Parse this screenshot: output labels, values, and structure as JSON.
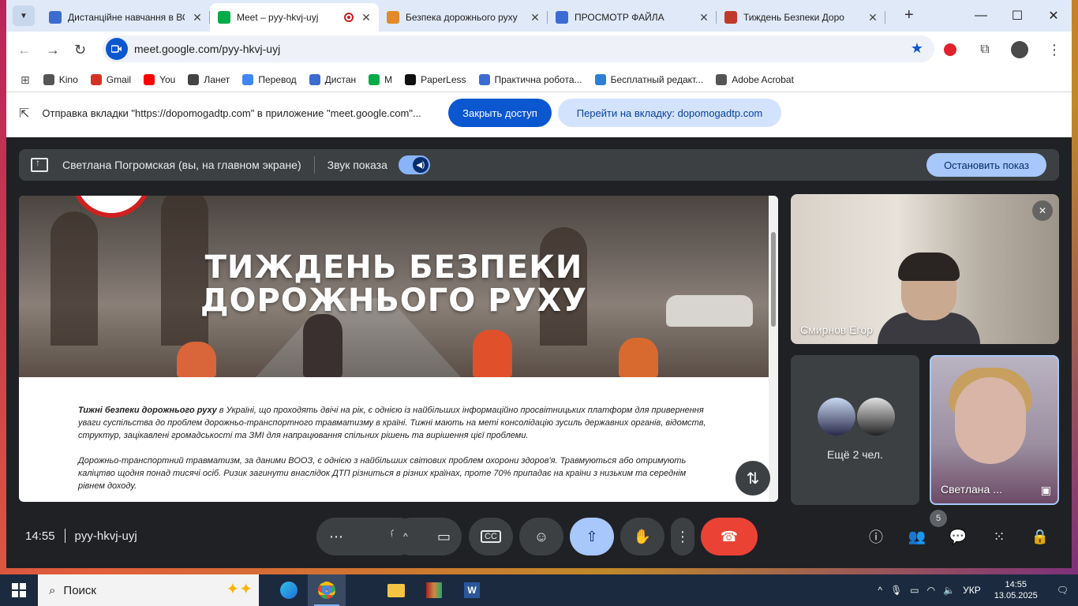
{
  "browser": {
    "tabs": [
      {
        "title": "Дистанційне навчання в ВС",
        "color": "#3c6bd1",
        "active": false
      },
      {
        "title": "Meet – pyy-hkvj-uyj",
        "color": "#00ac47",
        "active": true
      },
      {
        "title": "Безпека дорожнього руху",
        "color": "#e28a2a",
        "active": false
      },
      {
        "title": "ПРОСМОТР ФАЙЛА",
        "color": "#3c6bd1",
        "active": false
      },
      {
        "title": "Тиждень Безпеки Доро",
        "color": "#c0392b",
        "active": false
      }
    ],
    "url": "meet.google.com/pyy-hkvj-uyj",
    "bookmarks": [
      {
        "label": "Kino",
        "color": "#555555"
      },
      {
        "label": "Gmail",
        "color": "#d93025"
      },
      {
        "label": "You",
        "color": "#ff0000"
      },
      {
        "label": "Ланет",
        "color": "#444444"
      },
      {
        "label": "Перевод",
        "color": "#4285f4"
      },
      {
        "label": "Дистан",
        "color": "#3c6bd1"
      },
      {
        "label": "M",
        "color": "#00ac47"
      },
      {
        "label": "PaperLess",
        "color": "#111111"
      },
      {
        "label": "Практична робота...",
        "color": "#3c6bd1"
      },
      {
        "label": "Бесплатный редакт...",
        "color": "#2d7fd3"
      },
      {
        "label": "Adobe Acrobat",
        "color": "#555555"
      }
    ]
  },
  "infobar": {
    "text": "Отправка вкладки \"https://dopomogadtp.com\" в приложение \"meet.google.com\"...",
    "stop_label": "Закрыть доступ",
    "switch_label": "Перейти на вкладку: dopomogadtp.com"
  },
  "meet": {
    "presenting_label": "Светлана Погромская (вы, на главном экране)",
    "audio_label": "Звук показа",
    "stop_presenting_label": "Остановить показ",
    "shared": {
      "title_line1": "ТИЖДЕНЬ БЕЗПЕКИ",
      "title_line2": "ДОРОЖНЬОГО РУХУ",
      "para1_bold": "Тижні безпеки дорожнього руху",
      "para1_rest": " в Україні, що проходять двічі на рік, є однією із найбільших інформаційно просвітницьких платформ для привернення уваги суспільства до проблем дорожньо-транспортного травматизму в країні. Тижні мають на меті консолідацію зусиль державних органів, відомств, структур, зацікавлені громадськості та ЗМІ для напрацювання спільних рішень та вирішення цієї проблеми.",
      "para2": "Дорожньо-транспортний травматизм, за даними ВООЗ, є однією з найбільших світових проблем охорони здоров'я. Травмуються або отримують каліцтво щодня понад тисячі осіб. Ризик загинути внаслідок ДТП різниться в різних країнах, проте 70% припадає на країни з низьким та середнім рівнем доходу."
    },
    "participants": {
      "egor": "Смирнов Егор",
      "more": "Ещё 2 чел.",
      "self": "Светлана ..."
    },
    "time": "14:55",
    "meeting_code": "pyy-hkvj-uyj",
    "people_count": "5"
  },
  "taskbar": {
    "search_placeholder": "Поиск",
    "lang": "УКР",
    "time": "14:55",
    "date": "13.05.2025"
  }
}
